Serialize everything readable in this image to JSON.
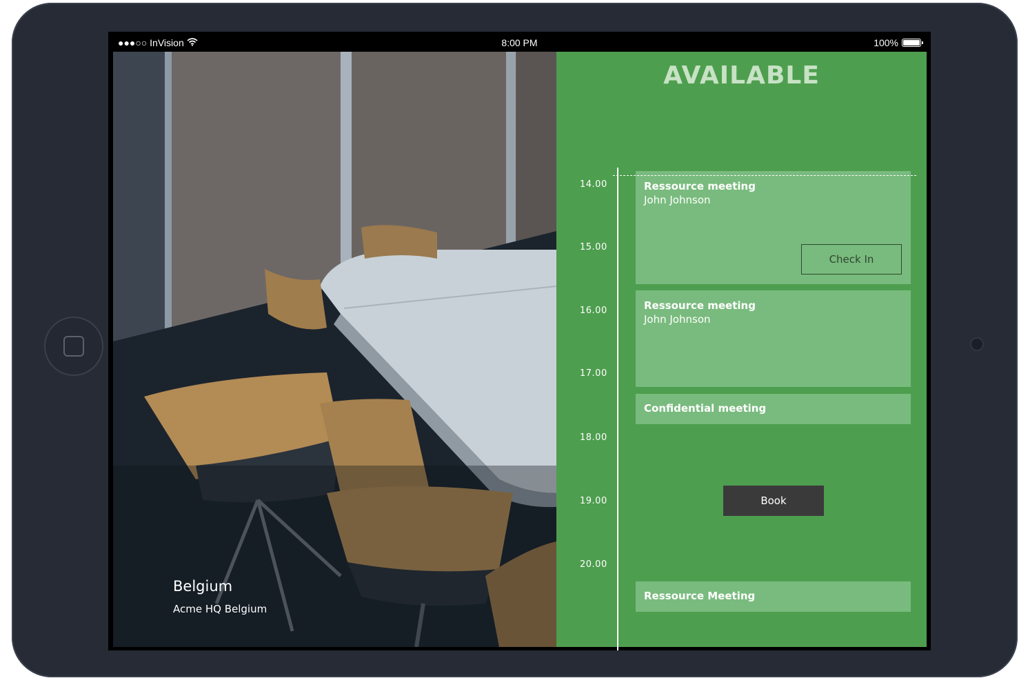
{
  "statusbar": {
    "carrier": "●●●○○ InVision",
    "time": "8:00 PM",
    "battery": "100%"
  },
  "room": {
    "name": "Belgium",
    "location": "Acme HQ Belgium"
  },
  "availability": {
    "status": "AVAILABLE",
    "status_color": "#4e9e4f"
  },
  "timeline": {
    "hours": [
      "14.00",
      "15.00",
      "16.00",
      "17.00",
      "18.00",
      "19.00",
      "20.00"
    ]
  },
  "events": [
    {
      "title": "Ressource meeting",
      "organizer": "John Johnson",
      "action": "Check In"
    },
    {
      "title": "Ressource meeting",
      "organizer": "John Johnson"
    },
    {
      "title": "Confidential meeting"
    },
    {
      "title": "Ressource Meeting"
    }
  ],
  "book_button": "Book",
  "icons": {
    "wifi": "wifi-icon",
    "battery": "battery-icon",
    "home": "home-button-icon"
  }
}
